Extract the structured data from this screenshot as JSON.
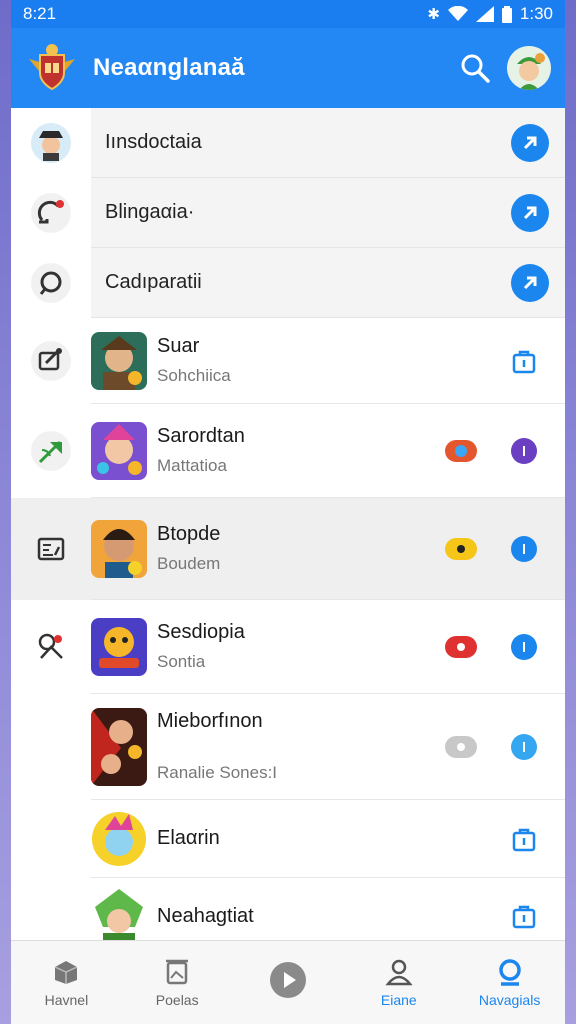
{
  "status": {
    "time": "8:21",
    "clock": "1:30"
  },
  "appbar": {
    "title": "Neaαnglanaă"
  },
  "quick_rows": [
    {
      "label": "Iınsdoctaia"
    },
    {
      "label": "Blingaαia·"
    },
    {
      "label": "Cadıparatii"
    }
  ],
  "apps": [
    {
      "title": "Suar",
      "subtitle": "Sohchiica"
    },
    {
      "title": "Sarordtan",
      "subtitle": "Mattatioa"
    },
    {
      "title": "Btopde",
      "subtitle": "Boudem"
    },
    {
      "title": "Sesdiopia",
      "subtitle": "Sontia"
    },
    {
      "title": "Mieborfınon",
      "subtitle": "Ranalie Sones:I"
    },
    {
      "title": "Elaαrin",
      "subtitle": ""
    },
    {
      "title": "Neahagtiat",
      "subtitle": ""
    }
  ],
  "nav": [
    {
      "label": "Havnel"
    },
    {
      "label": "Poelas"
    },
    {
      "label": ""
    },
    {
      "label": "Eiane"
    },
    {
      "label": "Navagials"
    }
  ],
  "colors": {
    "primary": "#2388f3",
    "pill_blue": "#e4572e",
    "pill_yellow": "#f5c518",
    "pill_red": "#e03131",
    "pill_grey": "#c8c8c8",
    "info_purple": "#6a3fc1",
    "info_blue": "#1b86ee",
    "info_lightblue": "#35a6f0"
  }
}
